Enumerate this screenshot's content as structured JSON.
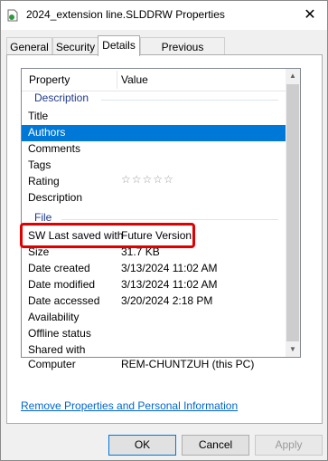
{
  "window": {
    "title": "2024_extension line.SLDDRW Properties",
    "close_glyph": "✕"
  },
  "tabs": [
    {
      "label": "General"
    },
    {
      "label": "Security"
    },
    {
      "label": "Details",
      "active": true
    },
    {
      "label": "Previous Versions"
    }
  ],
  "list": {
    "header": {
      "property": "Property",
      "value": "Value"
    },
    "groups": {
      "description": "Description",
      "file": "File"
    },
    "description_rows": [
      {
        "property": "Title",
        "value": ""
      },
      {
        "property": "Authors",
        "value": "",
        "selected": true
      },
      {
        "property": "Comments",
        "value": ""
      },
      {
        "property": "Tags",
        "value": ""
      },
      {
        "property": "Rating",
        "value": "☆☆☆☆☆"
      },
      {
        "property": "Description",
        "value": ""
      }
    ],
    "file_rows": [
      {
        "property": "SW Last saved with",
        "value": "Future Version"
      },
      {
        "property": "Size",
        "value": "31.7 KB"
      },
      {
        "property": "Date created",
        "value": "3/13/2024 11:02 AM"
      },
      {
        "property": "Date modified",
        "value": "3/13/2024 11:02 AM"
      },
      {
        "property": "Date accessed",
        "value": "3/20/2024 2:18 PM"
      },
      {
        "property": "Availability",
        "value": ""
      },
      {
        "property": "Offline status",
        "value": ""
      },
      {
        "property": "Shared with",
        "value": ""
      },
      {
        "property": "Computer",
        "value": "REM-CHUNTZUH (this PC)"
      }
    ]
  },
  "remove_link": "Remove Properties and Personal Information",
  "buttons": {
    "ok": "OK",
    "cancel": "Cancel",
    "apply": "Apply"
  },
  "colors": {
    "selection": "#0078d7",
    "highlight_box": "#e00000",
    "link": "#0066cc",
    "group_text": "#1e3a8a"
  }
}
